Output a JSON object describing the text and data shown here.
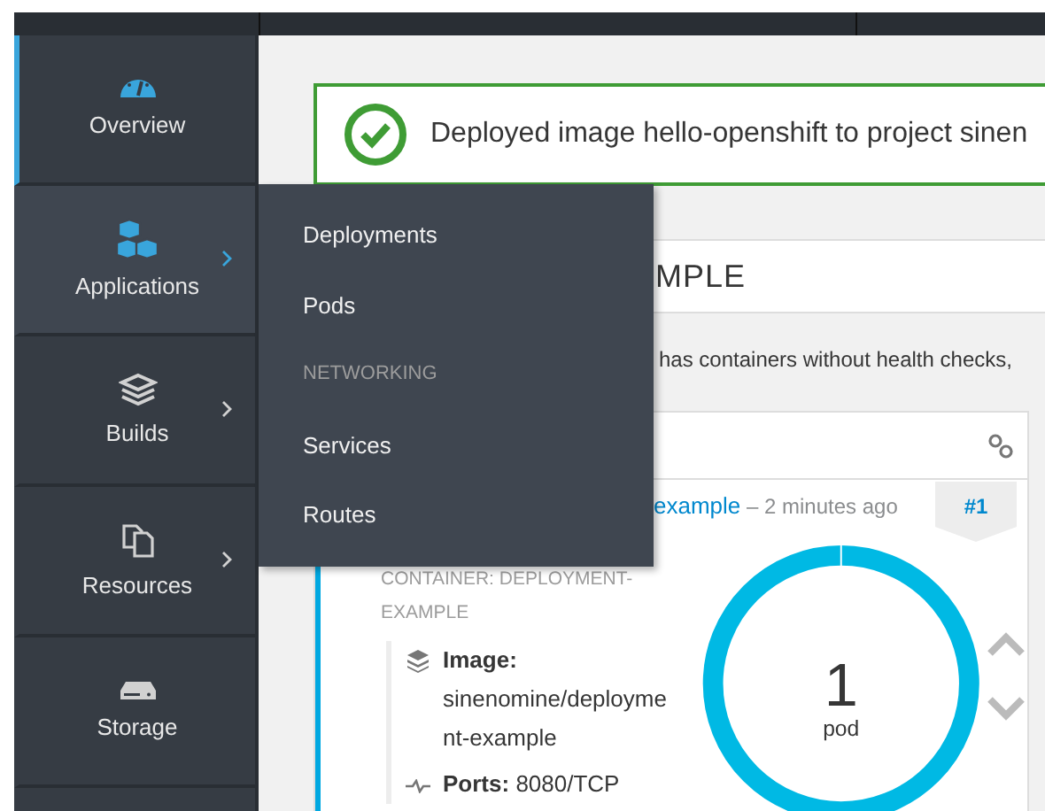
{
  "nav": [
    {
      "label": "Overview",
      "selected": true,
      "expanded": false,
      "submenu": false
    },
    {
      "label": "Applications",
      "selected": false,
      "expanded": true,
      "submenu": true
    },
    {
      "label": "Builds",
      "selected": false,
      "expanded": false,
      "submenu": true
    },
    {
      "label": "Resources",
      "selected": false,
      "expanded": false,
      "submenu": true
    },
    {
      "label": "Storage",
      "selected": false,
      "expanded": false,
      "submenu": false
    }
  ],
  "flyout": [
    {
      "kind": "link",
      "label": "Deployments"
    },
    {
      "kind": "link",
      "label": "Pods"
    },
    {
      "kind": "header",
      "label": "NETWORKING"
    },
    {
      "kind": "link",
      "label": "Services"
    },
    {
      "kind": "link",
      "label": "Routes"
    }
  ],
  "alert": {
    "message": "Deployed image hello-openshift to project sinen"
  },
  "header": {
    "title": "MPLE"
  },
  "warning": {
    "message": "has containers without health checks,"
  },
  "card": {
    "link": "example",
    "time": "– 2 minutes ago",
    "badge": "#1",
    "container_label": "CONTAINER: DEPLOYMENT-EXAMPLE",
    "details": [
      {
        "kind": "image",
        "label": "Image:",
        "value": "sinenomine/deployment-example"
      },
      {
        "kind": "ports",
        "label": "Ports:",
        "value": "8080/TCP"
      }
    ],
    "pods": {
      "count": "1",
      "unit": "pod"
    }
  }
}
